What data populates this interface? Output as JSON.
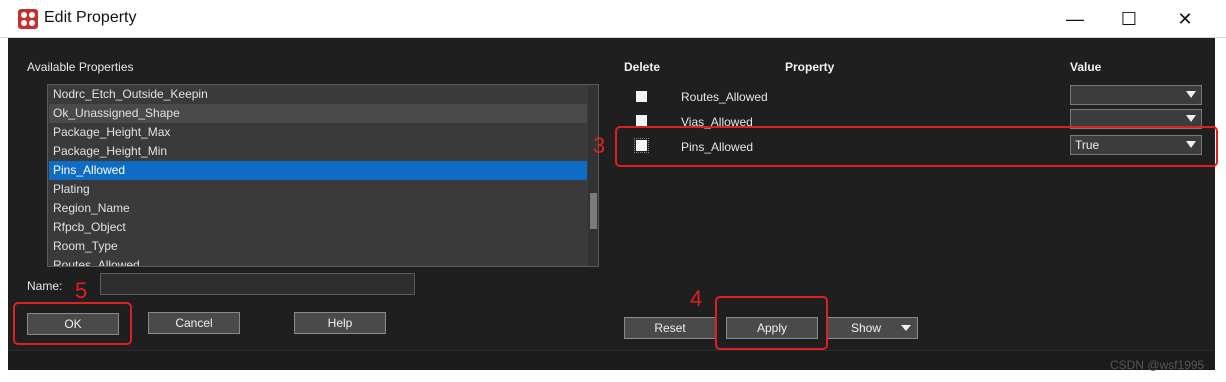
{
  "window": {
    "title": "Edit Property",
    "minimize_glyph": "—",
    "maximize_glyph": "☐",
    "close_glyph": "✕"
  },
  "available": {
    "label": "Available Properties",
    "items": [
      "Nodrc_Etch_Outside_Keepin",
      "Ok_Unassigned_Shape",
      "Package_Height_Max",
      "Package_Height_Min",
      "Pins_Allowed",
      "Plating",
      "Region_Name",
      "Rfpcb_Object",
      "Room_Type",
      "Routes_Allowed"
    ],
    "selected_index": 4,
    "hover_index": 1
  },
  "name_field": {
    "label": "Name:",
    "value": ""
  },
  "buttons": {
    "ok": "OK",
    "cancel": "Cancel",
    "help": "Help",
    "reset": "Reset",
    "apply": "Apply",
    "show": "Show"
  },
  "table": {
    "headers": {
      "delete": "Delete",
      "property": "Property",
      "value": "Value"
    },
    "rows": [
      {
        "property": "Routes_Allowed",
        "value": ""
      },
      {
        "property": "Vias_Allowed",
        "value": ""
      },
      {
        "property": "Pins_Allowed",
        "value": "True"
      }
    ]
  },
  "annotations": {
    "n3": "3",
    "n4": "4",
    "n5": "5"
  },
  "watermark": "CSDN @wsf1995",
  "colors": {
    "accent_selected": "#0f6cc5",
    "annotation_red": "#e02020",
    "dialog_bg": "#1f1f1f"
  }
}
